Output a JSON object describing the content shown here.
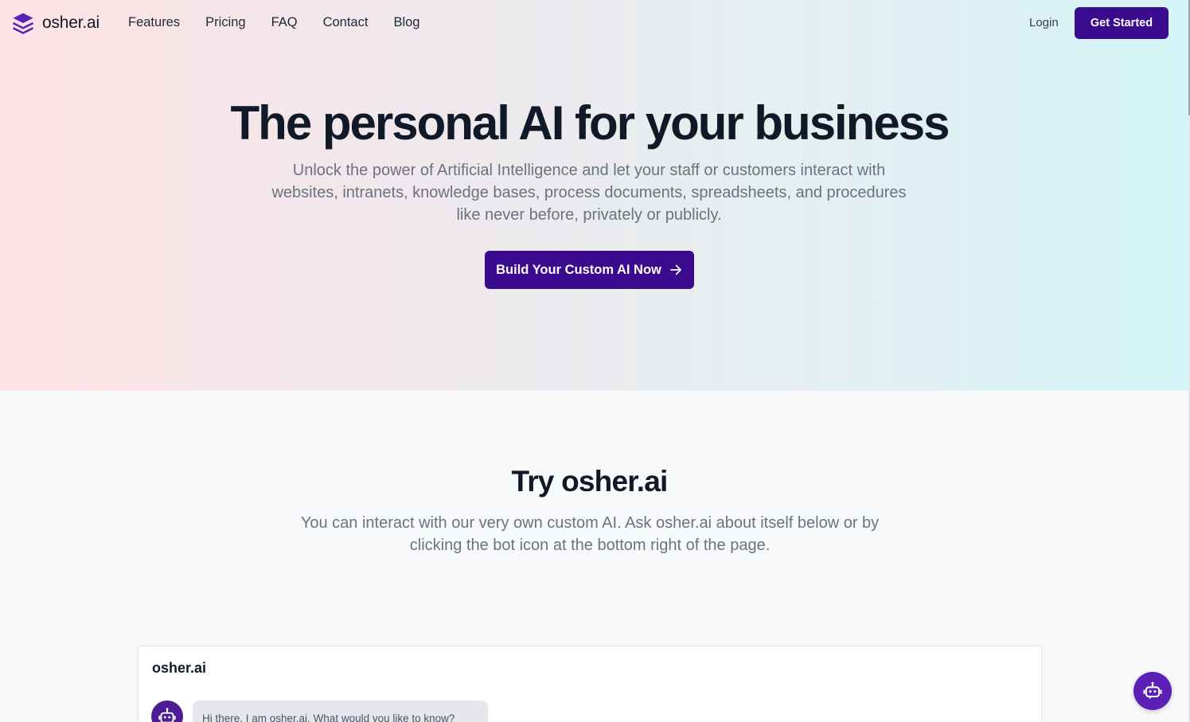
{
  "brand": {
    "name": "osher.ai",
    "icon": "layers-icon",
    "accent": "#3b0b8f"
  },
  "nav": {
    "links": [
      "Features",
      "Pricing",
      "FAQ",
      "Contact",
      "Blog"
    ],
    "login": "Login",
    "get_started": "Get Started"
  },
  "hero": {
    "title": "The personal AI for your business",
    "subtitle": "Unlock the power of Artificial Intelligence and let your staff or customers interact with websites, intranets, knowledge bases, process documents, spreadsheets, and procedures like never before, privately or publicly.",
    "cta": "Build Your Custom AI Now",
    "cta_icon": "arrow-right-icon",
    "gradient": [
      "#fde2e4",
      "#d4f4f7"
    ]
  },
  "try": {
    "title": "Try osher.ai",
    "subtitle": "You can interact with our very own custom AI. Ask osher.ai about itself below or by clicking the bot icon at the bottom right of the page."
  },
  "chat": {
    "title": "osher.ai",
    "bot_icon": "robot-icon",
    "messages": [
      {
        "from": "bot",
        "text": "Hi there, I am osher.ai. What would you like to know?"
      }
    ]
  },
  "chat_fab": {
    "icon": "robot-chat-icon",
    "color": "#5b21b6"
  }
}
